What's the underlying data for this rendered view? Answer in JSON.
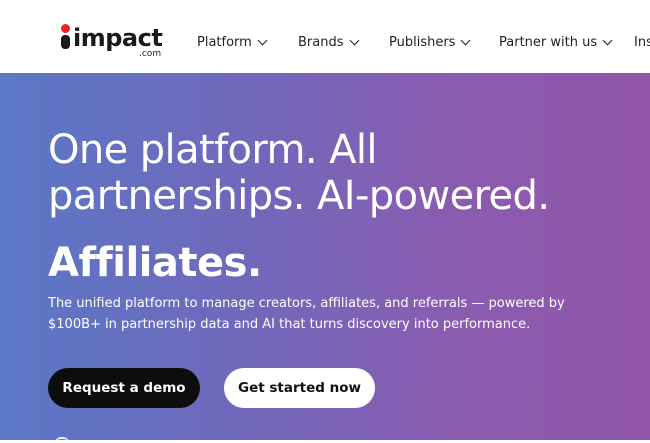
{
  "header": {
    "logo": {
      "word": "impact",
      "sub": ".com",
      "dot_color": "#e8242f"
    },
    "nav": [
      {
        "label": "Platform"
      },
      {
        "label": "Brands"
      },
      {
        "label": "Publishers"
      },
      {
        "label": "Partner with us"
      },
      {
        "label": "Ins"
      }
    ]
  },
  "hero": {
    "headline": "One platform. All partnerships. AI-powered.",
    "rotating_word": "Affiliates.",
    "subtext": "The unified platform to manage creators, affiliates, and referrals — powered by $100B+ in partnership data and AI that turns discovery into performance.",
    "buttons": {
      "demo": "Request a demo",
      "start": "Get started now"
    },
    "colors": {
      "gradient_start": "#5a78c6",
      "gradient_end": "#9256a8"
    }
  }
}
